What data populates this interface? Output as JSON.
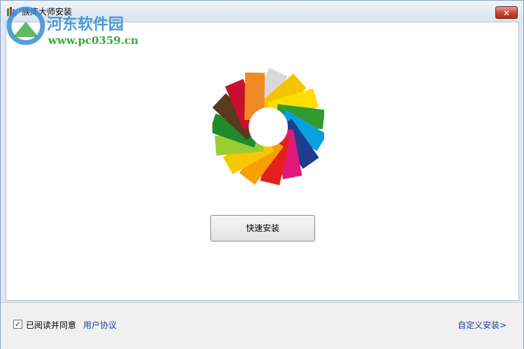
{
  "window": {
    "title": "族库大师安装",
    "close_label": "✕"
  },
  "main": {
    "install_button": "快速安装"
  },
  "footer": {
    "agree_checked": true,
    "agree_text": "已阅读并同意",
    "agreement_link": "用户协议",
    "custom_install": "自定义安装>"
  },
  "watermark": {
    "site_name": "河东软件园",
    "url": "www.pc0359.cn"
  },
  "logo_colors": [
    "#d9d9d9",
    "#f5c400",
    "#ffde00",
    "#2f9b2f",
    "#0aa0e0",
    "#1d3d8f",
    "#e0197a",
    "#e4201f",
    "#f5a000",
    "#f7c800",
    "#9acd32",
    "#1e8c2a",
    "#5a3a1e",
    "#c8102e",
    "#f08a24"
  ]
}
